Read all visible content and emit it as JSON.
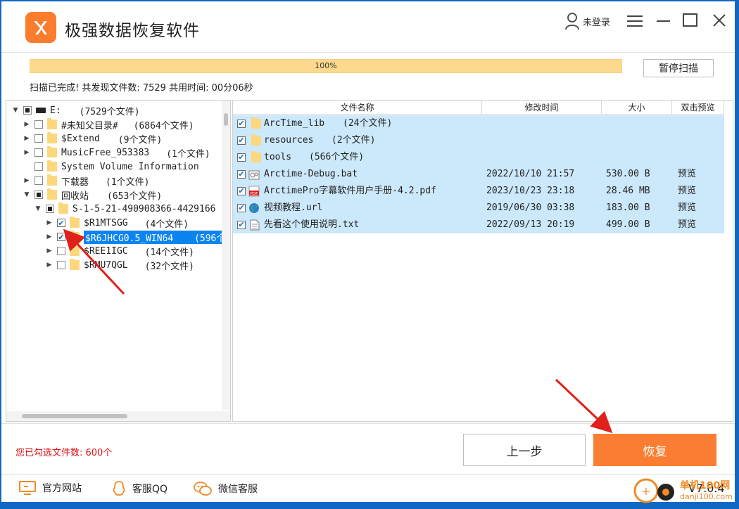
{
  "app": {
    "title": "极强数据恢复软件"
  },
  "titlebar": {
    "user_label": "未登录"
  },
  "scan": {
    "progress_text": "100%",
    "progress_fraction": 1.0,
    "pause_label": "暂停扫描",
    "status_text": "扫描已完成! 共发现文件数: 7529  共用时间: 00分06秒"
  },
  "tree": {
    "items": [
      {
        "label": "E:",
        "count": "(7529个文件)"
      },
      {
        "label": "#未知父目录#",
        "count": "(6864个文件)"
      },
      {
        "label": "$Extend",
        "count": "(9个文件)"
      },
      {
        "label": "MusicFree_953383",
        "count": "(1个文件)"
      },
      {
        "label": "System Volume Information",
        "count": ""
      },
      {
        "label": "下载器",
        "count": "(1个文件)"
      },
      {
        "label": "回收站",
        "count": "(653个文件)"
      },
      {
        "label": "S-1-5-21-490908366-4429166",
        "count": ""
      },
      {
        "label": "$R1MTSGG",
        "count": "(4个文件)"
      },
      {
        "label": "$R6JHCG0.5_WIN64",
        "count": "(596个"
      },
      {
        "label": "$REE1IGC",
        "count": "(14个文件)"
      },
      {
        "label": "$RMU7QGL",
        "count": "(32个文件)"
      }
    ]
  },
  "files": {
    "columns": [
      "文件名称",
      "修改时间",
      "大小",
      "双击预览"
    ],
    "rows": [
      {
        "name": "ArcTime_lib",
        "extra": "(24个文件)",
        "time": "",
        "size": "",
        "preview": "",
        "icon": "folder-icon"
      },
      {
        "name": "resources",
        "extra": "(2个文件)",
        "time": "",
        "size": "",
        "preview": "",
        "icon": "folder-icon"
      },
      {
        "name": "tools",
        "extra": "(566个文件)",
        "time": "",
        "size": "",
        "preview": "",
        "icon": "folder-icon"
      },
      {
        "name": "Arctime-Debug.bat",
        "extra": "",
        "time": "2022/10/10 21:57",
        "size": "530.00 B",
        "preview": "预览",
        "icon": "bat-file-icon"
      },
      {
        "name": "ArctimePro字幕软件用户手册-4.2.pdf",
        "extra": "",
        "time": "2023/10/23 23:18",
        "size": "28.46 MB",
        "preview": "预览",
        "icon": "pdf-file-icon"
      },
      {
        "name": "视频教程.url",
        "extra": "",
        "time": "2019/06/30 03:38",
        "size": "183.00 B",
        "preview": "预览",
        "icon": "globe-icon"
      },
      {
        "name": "先看这个使用说明.txt",
        "extra": "",
        "time": "2022/09/13 20:19",
        "size": "499.00 B",
        "preview": "预览",
        "icon": "text-file-icon"
      }
    ]
  },
  "bottom": {
    "selected_count": "您已勾选文件数: 600个",
    "prev_label": "上一步",
    "recover_label": "恢复"
  },
  "footer": {
    "website": "官方网站",
    "qq": "客服QQ",
    "wechat": "微信客服",
    "version": "V7.0.4"
  },
  "watermark": {
    "text": "单机100网",
    "url": "danji100.com"
  },
  "colors": {
    "accent": "#fb7d33",
    "selection": "#0b84f0",
    "row_highlight": "#cce8fb",
    "window_border": "#1167c4"
  }
}
